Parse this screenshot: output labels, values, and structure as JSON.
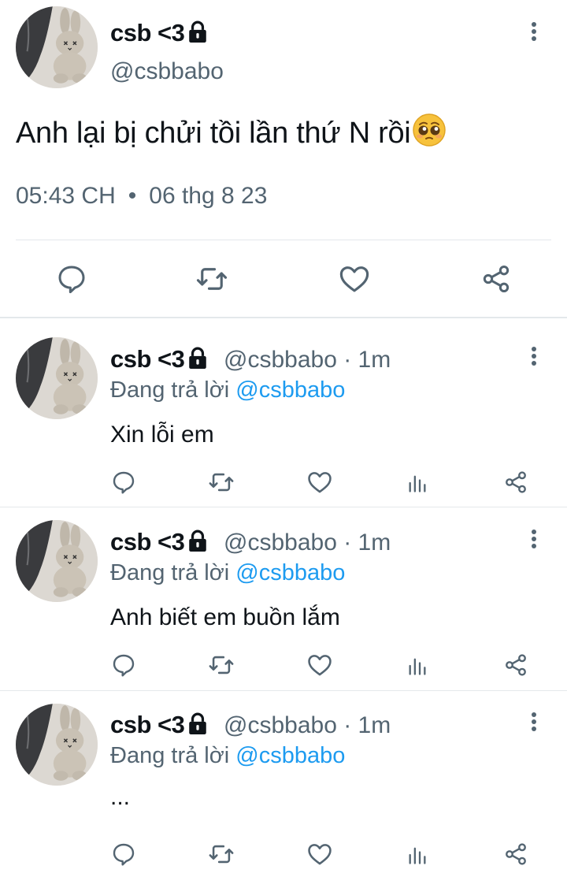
{
  "tweet": {
    "display_name": "csb <3",
    "handle": "@csbbabo",
    "text": "Anh lại bị chửi tồi lần thứ N rồi",
    "emoji": "pleading-face",
    "time": "05:43 CH",
    "separator": "•",
    "date": "06 thg 8 23",
    "actions": [
      "reply-icon",
      "retweet-icon",
      "like-icon",
      "share-icon"
    ]
  },
  "replies": [
    {
      "display_name": "csb <3",
      "handle_time": "@csbbabo · 1m",
      "reply_prefix": "Đang trả lời",
      "reply_to": "@csbbabo",
      "text": "Xin lỗi em"
    },
    {
      "display_name": "csb <3",
      "handle_time": "@csbbabo · 1m",
      "reply_prefix": "Đang trả lời",
      "reply_to": "@csbbabo",
      "text": "Anh biết em buồn lắm"
    },
    {
      "display_name": "csb <3",
      "handle_time": "@csbbabo · 1m",
      "reply_prefix": "Đang trả lời",
      "reply_to": "@csbbabo",
      "text": "..."
    }
  ],
  "colors": {
    "text": "#0f1419",
    "secondary": "#536471",
    "link": "#1d9bf0",
    "divider": "#e4e8eb"
  }
}
